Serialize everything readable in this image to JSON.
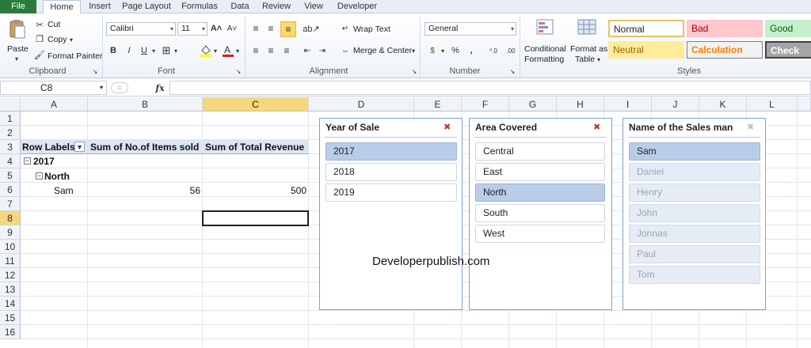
{
  "ribbon_tabs": [
    "File",
    "Home",
    "Insert",
    "Page Layout",
    "Formulas",
    "Data",
    "Review",
    "View",
    "Developer"
  ],
  "clipboard": {
    "paste": "Paste",
    "cut": "Cut",
    "copy": "Copy",
    "format_painter": "Format Painter",
    "label": "Clipboard"
  },
  "font": {
    "name": "Calibri",
    "size": "11",
    "label": "Font",
    "bold": "B",
    "italic": "I",
    "underline": "U",
    "grow": "A",
    "shrink": "A"
  },
  "alignment": {
    "wrap_text": "Wrap Text",
    "merge_center": "Merge & Center",
    "label": "Alignment"
  },
  "number": {
    "format": "General",
    "label": "Number",
    "currency": "$",
    "percent": "%",
    "comma": ",",
    "inc_decimal": "⁰.0",
    "dec_decimal": ".00"
  },
  "styles": {
    "conditional_1": "Conditional",
    "conditional_2": "Formatting",
    "format_table_1": "Format as",
    "format_table_2": "Table",
    "normal": "Normal",
    "bad": "Bad",
    "good": "Good",
    "neutral": "Neutral",
    "calculation": "Calculation",
    "check_cell": "Check Cel",
    "label": "Styles"
  },
  "formula_bar": {
    "name_box": "C8",
    "fx": "fx",
    "content": ""
  },
  "columns": [
    "A",
    "B",
    "C",
    "D",
    "E",
    "F",
    "G",
    "H",
    "I",
    "J",
    "K",
    "L"
  ],
  "rows": [
    "1",
    "2",
    "3",
    "4",
    "5",
    "6",
    "7",
    "8",
    "9",
    "10",
    "11",
    "12",
    "13",
    "14",
    "15",
    "16"
  ],
  "pivot": {
    "header_row_labels": "Row Labels",
    "header_items": "Sum of No.of Items sold",
    "header_revenue": "Sum of Total Revenue",
    "year": "2017",
    "area": "North",
    "person": "Sam",
    "items": "56",
    "revenue": "500"
  },
  "slicers": {
    "year": {
      "title": "Year of Sale",
      "items": [
        "2017",
        "2018",
        "2019"
      ]
    },
    "area": {
      "title": "Area Covered",
      "items": [
        "Central",
        "East",
        "North",
        "South",
        "West"
      ]
    },
    "salesman": {
      "title": "Name of the Sales man",
      "items": [
        "Sam",
        "Daniel",
        "Henry",
        "John",
        "Jonnas",
        "Paul",
        "Tom"
      ]
    }
  },
  "watermark": "Developerpublish.com",
  "colors": {
    "file_tab": "#2a7a3b",
    "selected_header": "#f7d77c",
    "slicer_selected": "#b9cde8",
    "slicer_border": "#7da2cf"
  }
}
